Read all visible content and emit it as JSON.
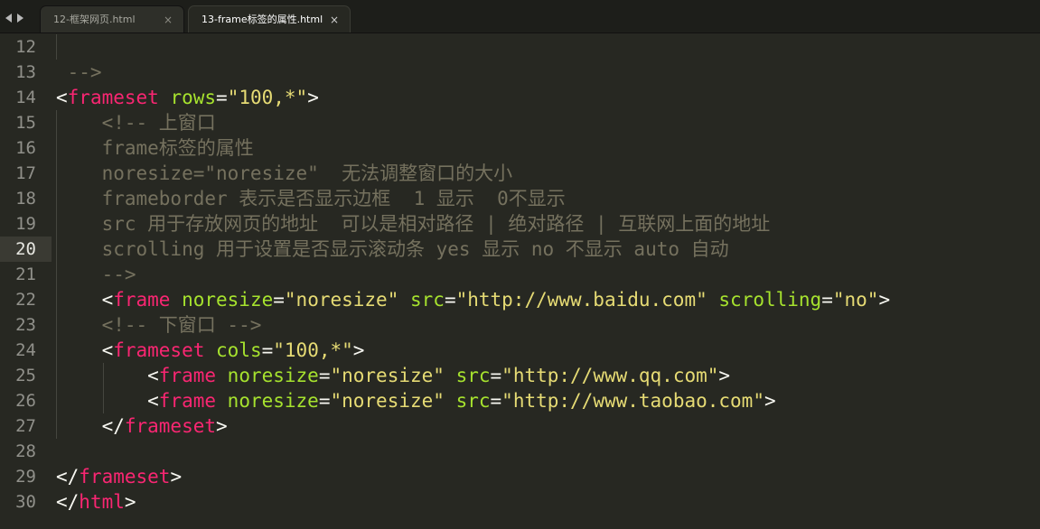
{
  "tabs": [
    {
      "label": "12-框架网页.html",
      "close": "×",
      "active": false
    },
    {
      "label": "13-frame标签的属性.html",
      "close": "×",
      "active": true
    }
  ],
  "current_line": "20",
  "lines": [
    {
      "num": "12",
      "tokens": []
    },
    {
      "num": "13",
      "tokens": [
        {
          "t": " -->",
          "c": "cm"
        }
      ]
    },
    {
      "num": "14",
      "tokens": [
        {
          "t": "<",
          "c": "pu"
        },
        {
          "t": "frameset",
          "c": "tg"
        },
        {
          "t": " ",
          "c": "pu"
        },
        {
          "t": "rows",
          "c": "at"
        },
        {
          "t": "=",
          "c": "pu"
        },
        {
          "t": "\"100,*\"",
          "c": "st"
        },
        {
          "t": ">",
          "c": "pu"
        }
      ]
    },
    {
      "num": "15",
      "tokens": [
        {
          "t": "    <!-- 上窗口",
          "c": "cm"
        }
      ]
    },
    {
      "num": "16",
      "tokens": [
        {
          "t": "    frame标签的属性",
          "c": "cm"
        }
      ]
    },
    {
      "num": "17",
      "tokens": [
        {
          "t": "    noresize=\"noresize\"  无法调整窗口的大小",
          "c": "cm"
        }
      ]
    },
    {
      "num": "18",
      "tokens": [
        {
          "t": "    frameborder 表示是否显示边框  1 显示  0不显示",
          "c": "cm"
        }
      ]
    },
    {
      "num": "19",
      "tokens": [
        {
          "t": "    src 用于存放网页的地址  可以是相对路径 | 绝对路径 | 互联网上面的地址",
          "c": "cm"
        }
      ]
    },
    {
      "num": "20",
      "tokens": [
        {
          "t": "    scrolling 用于设置是否显示滚动条 yes 显示 no 不显示 auto 自动",
          "c": "cm"
        }
      ]
    },
    {
      "num": "21",
      "tokens": [
        {
          "t": "    -->",
          "c": "cm"
        }
      ]
    },
    {
      "num": "22",
      "tokens": [
        {
          "t": "    <",
          "c": "pu"
        },
        {
          "t": "frame",
          "c": "tg"
        },
        {
          "t": " ",
          "c": "pu"
        },
        {
          "t": "noresize",
          "c": "at"
        },
        {
          "t": "=",
          "c": "pu"
        },
        {
          "t": "\"noresize\"",
          "c": "st"
        },
        {
          "t": " ",
          "c": "pu"
        },
        {
          "t": "src",
          "c": "at"
        },
        {
          "t": "=",
          "c": "pu"
        },
        {
          "t": "\"http://www.baidu.com\"",
          "c": "st"
        },
        {
          "t": " ",
          "c": "pu"
        },
        {
          "t": "scrolling",
          "c": "at"
        },
        {
          "t": "=",
          "c": "pu"
        },
        {
          "t": "\"no\"",
          "c": "st"
        },
        {
          "t": ">",
          "c": "pu"
        }
      ]
    },
    {
      "num": "23",
      "tokens": [
        {
          "t": "    <!-- 下窗口 -->",
          "c": "cm"
        }
      ]
    },
    {
      "num": "24",
      "tokens": [
        {
          "t": "    <",
          "c": "pu"
        },
        {
          "t": "frameset",
          "c": "tg"
        },
        {
          "t": " ",
          "c": "pu"
        },
        {
          "t": "cols",
          "c": "at"
        },
        {
          "t": "=",
          "c": "pu"
        },
        {
          "t": "\"100,*\"",
          "c": "st"
        },
        {
          "t": ">",
          "c": "pu"
        }
      ]
    },
    {
      "num": "25",
      "tokens": [
        {
          "t": "        <",
          "c": "pu"
        },
        {
          "t": "frame",
          "c": "tg"
        },
        {
          "t": " ",
          "c": "pu"
        },
        {
          "t": "noresize",
          "c": "at"
        },
        {
          "t": "=",
          "c": "pu"
        },
        {
          "t": "\"noresize\"",
          "c": "st"
        },
        {
          "t": " ",
          "c": "pu"
        },
        {
          "t": "src",
          "c": "at"
        },
        {
          "t": "=",
          "c": "pu"
        },
        {
          "t": "\"http://www.qq.com\"",
          "c": "st"
        },
        {
          "t": ">",
          "c": "pu"
        }
      ]
    },
    {
      "num": "26",
      "tokens": [
        {
          "t": "        <",
          "c": "pu"
        },
        {
          "t": "frame",
          "c": "tg"
        },
        {
          "t": " ",
          "c": "pu"
        },
        {
          "t": "noresize",
          "c": "at"
        },
        {
          "t": "=",
          "c": "pu"
        },
        {
          "t": "\"noresize\"",
          "c": "st"
        },
        {
          "t": " ",
          "c": "pu"
        },
        {
          "t": "src",
          "c": "at"
        },
        {
          "t": "=",
          "c": "pu"
        },
        {
          "t": "\"http://www.taobao.com\"",
          "c": "st"
        },
        {
          "t": ">",
          "c": "pu"
        }
      ]
    },
    {
      "num": "27",
      "tokens": [
        {
          "t": "    </",
          "c": "pu"
        },
        {
          "t": "frameset",
          "c": "tg"
        },
        {
          "t": ">",
          "c": "pu"
        }
      ]
    },
    {
      "num": "28",
      "tokens": []
    },
    {
      "num": "29",
      "tokens": [
        {
          "t": "</",
          "c": "pu"
        },
        {
          "t": "frameset",
          "c": "tg"
        },
        {
          "t": ">",
          "c": "pu"
        }
      ]
    },
    {
      "num": "30",
      "tokens": [
        {
          "t": "</",
          "c": "pu"
        },
        {
          "t": "html",
          "c": "tg"
        },
        {
          "t": ">",
          "c": "pu"
        }
      ]
    }
  ],
  "colors": {
    "background": "#272822",
    "comment": "#75715e",
    "tag": "#f92672",
    "attribute": "#a6e22e",
    "string": "#e6db74",
    "text": "#f8f8f2"
  }
}
